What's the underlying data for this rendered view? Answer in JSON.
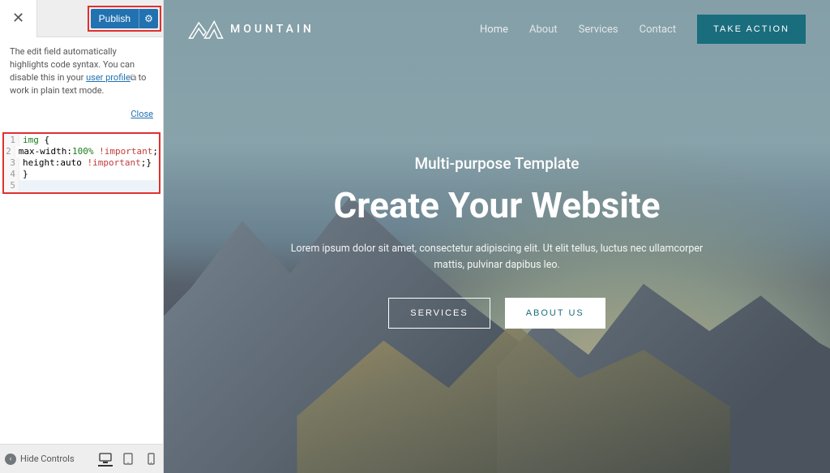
{
  "customizer": {
    "publish_label": "Publish",
    "desc_pre": "The edit field automatically highlights code syntax. You can disable this in your ",
    "desc_link": "user profile",
    "desc_post": " to work in plain text mode.",
    "close_label": "Close",
    "code_lines": [
      {
        "n": "1",
        "tokens": [
          [
            "tag",
            "img"
          ],
          [
            "plain",
            " {"
          ]
        ]
      },
      {
        "n": "2",
        "tokens": [
          [
            "prop",
            "max-width:"
          ],
          [
            "num",
            "100%"
          ],
          [
            "plain",
            " "
          ],
          [
            "imp",
            "!important"
          ],
          [
            "plain",
            ";"
          ]
        ]
      },
      {
        "n": "3",
        "tokens": [
          [
            "prop",
            "height:"
          ],
          [
            "prop",
            "auto"
          ],
          [
            "plain",
            " "
          ],
          [
            "imp",
            "!important"
          ],
          [
            "plain",
            ";}"
          ]
        ]
      },
      {
        "n": "4",
        "tokens": [
          [
            "plain",
            "}"
          ]
        ]
      },
      {
        "n": "5",
        "tokens": []
      }
    ],
    "hide_controls": "Hide Controls"
  },
  "site": {
    "brand": "MOUNTAIN",
    "nav": {
      "home": "Home",
      "about": "About",
      "services": "Services",
      "contact": "Contact"
    },
    "cta": "TAKE ACTION",
    "hero": {
      "sub": "Multi-purpose Template",
      "title": "Create Your Website",
      "desc": "Lorem ipsum dolor sit amet, consectetur adipiscing elit. Ut elit tellus, luctus nec ullamcorper mattis, pulvinar dapibus leo.",
      "btn1": "SERVICES",
      "btn2": "ABOUT US"
    }
  }
}
